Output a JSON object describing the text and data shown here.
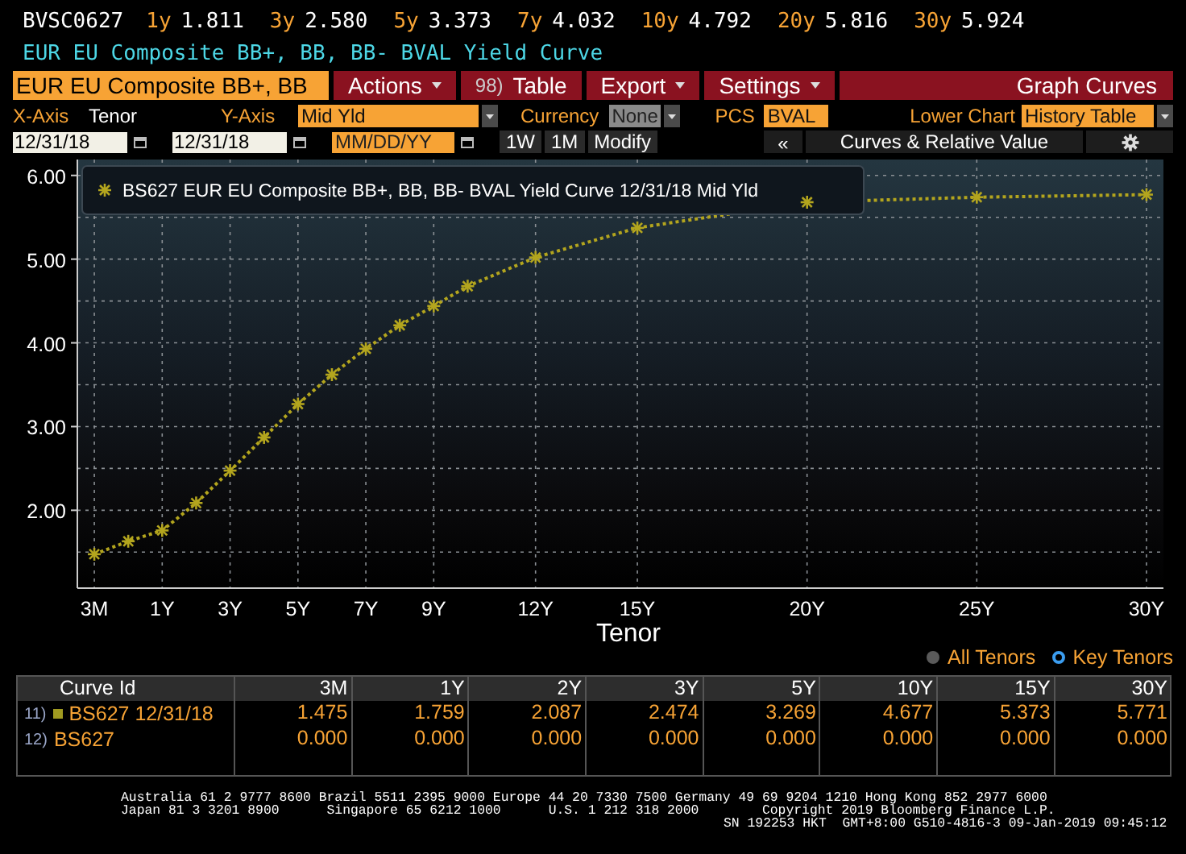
{
  "quote_bar": {
    "ticker": "BVSC0627",
    "quotes": [
      {
        "tenor": "1y",
        "value": "1.811"
      },
      {
        "tenor": "3y",
        "value": "2.580"
      },
      {
        "tenor": "5y",
        "value": "3.373"
      },
      {
        "tenor": "7y",
        "value": "4.032"
      },
      {
        "tenor": "10y",
        "value": "4.792"
      },
      {
        "tenor": "20y",
        "value": "5.816"
      },
      {
        "tenor": "30y",
        "value": "5.924"
      }
    ]
  },
  "title": "EUR EU Composite BB+, BB, BB- BVAL Yield Curve",
  "toolbar": {
    "security_field": "EUR EU Composite BB+, BB",
    "menus": [
      {
        "kind": "dropdown",
        "label": "Actions"
      },
      {
        "kind": "numbered",
        "number": "98)",
        "label": "Table"
      },
      {
        "kind": "dropdown",
        "label": "Export"
      },
      {
        "kind": "dropdown",
        "label": "Settings"
      }
    ],
    "right_label": "Graph Curves"
  },
  "axis_settings": {
    "x_axis_label": "X-Axis",
    "x_axis_value": "Tenor",
    "y_axis_label": "Y-Axis",
    "y_axis_value": "Mid Yld",
    "currency_label": "Currency",
    "currency_value": "None",
    "pcs_label": "PCS",
    "pcs_value": "BVAL",
    "lower_chart_label": "Lower Chart",
    "lower_chart_value": "History Table"
  },
  "date_bar": {
    "start_date": "12/31/18",
    "end_date": "12/31/18",
    "date_placeholder": "MM/DD/YY",
    "buttons": [
      "1W",
      "1M",
      "Modify"
    ],
    "collapse": "«",
    "panel_label": "Curves & Relative Value"
  },
  "chart": {
    "chart_data": {
      "type": "line",
      "xlabel": "Tenor",
      "categories": [
        "3M",
        null,
        "1Y",
        null,
        "3Y",
        null,
        "5Y",
        null,
        "7Y",
        null,
        "9Y",
        null,
        null,
        "12Y",
        null,
        null,
        "15Y",
        null,
        null,
        null,
        null,
        "20Y",
        null,
        null,
        null,
        null,
        "25Y",
        null,
        null,
        null,
        null,
        "30Y"
      ],
      "series": [
        {
          "name": "BS627 EUR EU Composite BB+, BB, BB- BVAL Yield Curve 12/31/18 Mid Yld",
          "color": "#b3a51e",
          "line_style": "dotted",
          "marker": "cross",
          "values": [
            1.475,
            1.63,
            1.759,
            2.087,
            2.474,
            2.87,
            3.269,
            3.62,
            3.93,
            4.21,
            4.44,
            4.677,
            null,
            5.02,
            null,
            null,
            5.373,
            null,
            null,
            null,
            null,
            5.68,
            null,
            null,
            null,
            null,
            5.74,
            null,
            null,
            null,
            null,
            5.771
          ]
        }
      ],
      "ylim": [
        1.07,
        6.19
      ],
      "grid": true,
      "yticks": [
        {
          "value": 2,
          "label": "2.00"
        },
        {
          "value": 3,
          "label": "3.00"
        },
        {
          "value": 4,
          "label": "4.00"
        },
        {
          "value": 5,
          "label": "5.00"
        },
        {
          "value": 6,
          "label": "6.00"
        }
      ]
    }
  },
  "tenor_mode": [
    {
      "label": "All Tenors",
      "selected": false
    },
    {
      "label": "Key Tenors",
      "selected": true
    }
  ],
  "table": {
    "columns": [
      "Curve Id",
      "3M",
      "1Y",
      "2Y",
      "3Y",
      "5Y",
      "10Y",
      "15Y",
      "30Y"
    ],
    "rows": [
      {
        "number": "11)",
        "curve_id": "BS627 12/31/18",
        "color": "#a09a20",
        "values": [
          "1.475",
          "1.759",
          "2.087",
          "2.474",
          "3.269",
          "4.677",
          "5.373",
          "5.771"
        ]
      },
      {
        "number": "12)",
        "curve_id": "BS627",
        "values": [
          "0.000",
          "0.000",
          "0.000",
          "0.000",
          "0.000",
          "0.000",
          "0.000",
          "0.000"
        ]
      }
    ]
  },
  "footer": [
    "Australia 61 2 9777 8600 Brazil 5511 2395 9000 Europe 44 20 7330 7500 Germany 49 69 9204 1210 Hong Kong 852 2977 6000",
    "Japan 81 3 3201 8900      Singapore 65 6212 1000      U.S. 1 212 318 2000        Copyright 2019 Bloomberg Finance L.P.",
    "SN 192253 HKT  GMT+8:00 G510-4816-3 09-Jan-2019 09:45:12"
  ]
}
